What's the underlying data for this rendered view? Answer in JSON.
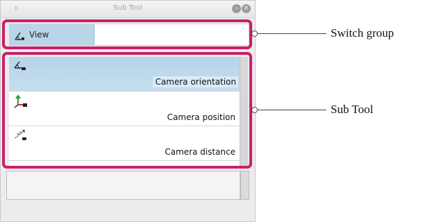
{
  "window": {
    "title": "Sub Tool",
    "grip_glyph": "⁞⁞",
    "minimize_glyph": "–",
    "close_glyph": "×"
  },
  "switch_group": {
    "label": "View",
    "icon": "view-angle-icon"
  },
  "sub_tools": [
    {
      "label": "Camera orientation",
      "icon": "camera-orientation-icon",
      "selected": true
    },
    {
      "label": "Camera position",
      "icon": "camera-position-icon",
      "selected": false
    },
    {
      "label": "Camera distance",
      "icon": "camera-distance-icon",
      "selected": false
    }
  ],
  "callouts": {
    "switch_group": "Switch group",
    "sub_tool": "Sub Tool"
  },
  "colors": {
    "highlight": "#c8206a",
    "selected_bg": "#b5d3e8"
  }
}
